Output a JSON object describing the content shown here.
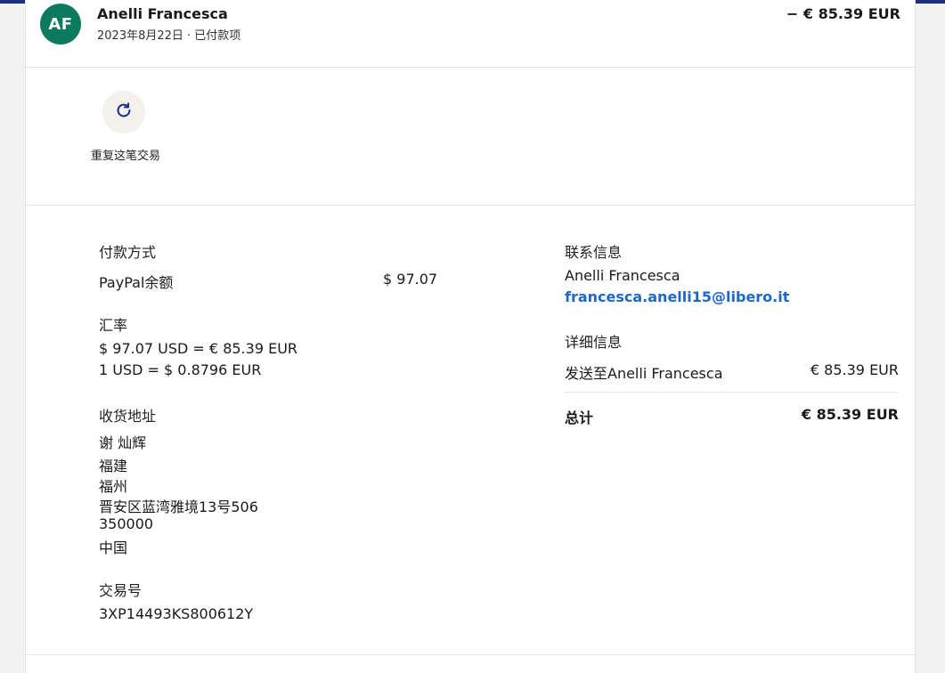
{
  "header": {
    "avatar_initials": "AF",
    "name": "Anelli Francesca",
    "date_status": "2023年8月22日 · 已付款项",
    "amount": "− € 85.39 EUR"
  },
  "actions": {
    "repeat_label": "重复这笔交易",
    "repeat_icon": "refresh-icon"
  },
  "payment": {
    "heading": "付款方式",
    "method": "PayPal余额",
    "method_amount": "$ 97.07"
  },
  "exchange": {
    "heading": "汇率",
    "line1": "$ 97.07 USD = € 85.39 EUR",
    "line2": "1 USD = $ 0.8796 EUR"
  },
  "shipping": {
    "heading": "收货地址",
    "lines": [
      "谢 灿辉",
      "福建",
      "福州",
      "晋安区蓝湾雅境13号506",
      "350000",
      "中国"
    ]
  },
  "transaction": {
    "heading": "交易号",
    "id": "3XP14493KS800612Y"
  },
  "contact": {
    "heading": "联系信息",
    "name": "Anelli Francesca",
    "email": "francesca.anelli15@libero.it"
  },
  "details": {
    "heading": "详细信息",
    "sent_to_label": "发送至Anelli Francesca",
    "sent_to_amount": "€ 85.39 EUR",
    "total_label": "总计",
    "total_amount": "€ 85.39 EUR"
  },
  "colors": {
    "brand_bar": "#1a2f85",
    "avatar_bg": "#0c7a5e",
    "link": "#1f67c9"
  }
}
